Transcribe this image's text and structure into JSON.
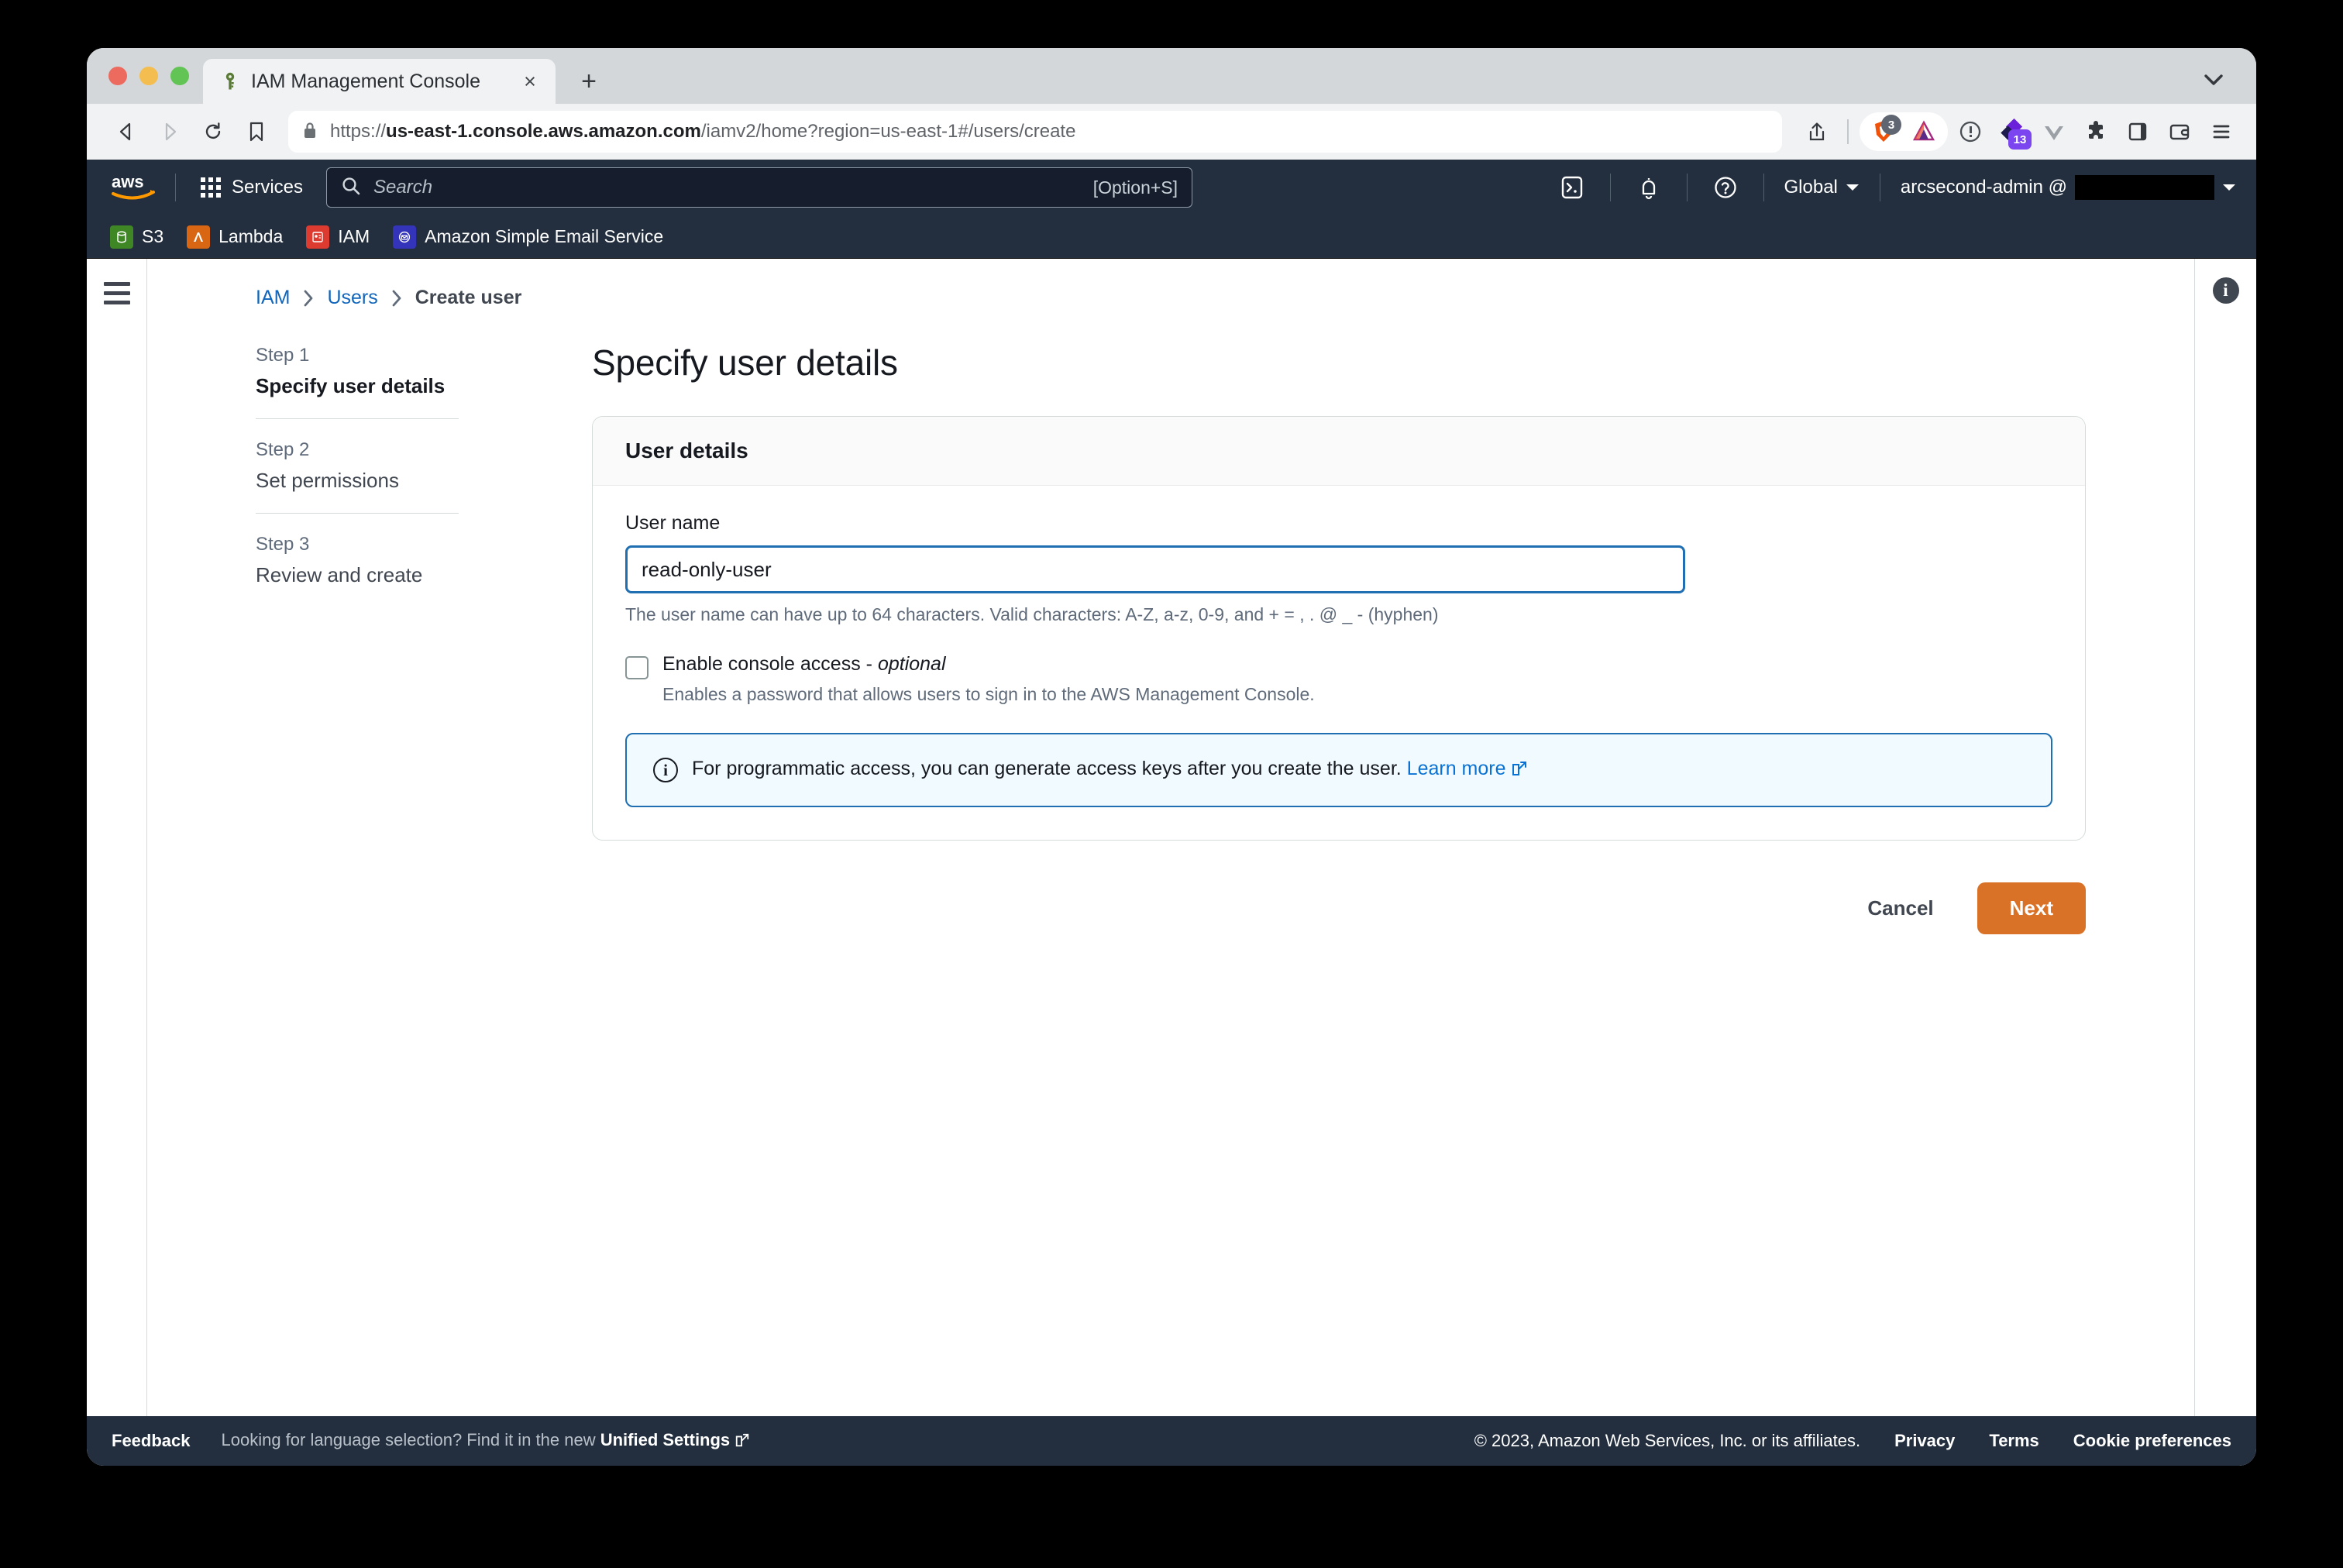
{
  "browser": {
    "tab": {
      "title": "IAM Management Console",
      "favicon": "key-icon",
      "close": "×"
    },
    "newtab_label": "+",
    "url_scheme": "https://",
    "url_domain": "us-east-1.console.aws.amazon.com",
    "url_path": "/iamv2/home?region=us-east-1#/users/create",
    "url_full": "https://us-east-1.console.aws.amazon.com/iamv2/home?region=us-east-1#/users/create",
    "toolbar": {
      "back": "back-icon",
      "forward": "forward-icon",
      "reload": "reload-icon",
      "bookmark": "bookmark-icon",
      "share": "share-icon",
      "brave_shield_count": "3",
      "brave_rewards": "bat-triangle-icon",
      "onepassword": "1password-icon",
      "extension_badge_count": "13",
      "vue_devtools": "vue-icon",
      "puzzle": "extensions-icon",
      "sidebar": "sidebar-icon",
      "wallet": "wallet-icon",
      "menu": "hamburger-menu-icon"
    }
  },
  "aws_nav": {
    "logo": "aws-logo",
    "services_label": "Services",
    "search_placeholder": "Search",
    "search_shortcut": "[Option+S]",
    "cloudshell": "cloudshell-icon",
    "notifications": "bell-icon",
    "help": "help-icon",
    "region": "Global",
    "account": "arcsecond-admin @",
    "account_redacted": true
  },
  "favorites": [
    {
      "label": "S3",
      "icon": "s3-icon",
      "color": "#3f8624"
    },
    {
      "label": "Lambda",
      "icon": "lambda-icon",
      "color": "#d86613"
    },
    {
      "label": "IAM",
      "icon": "iam-icon",
      "color": "#dd3b30"
    },
    {
      "label": "Amazon Simple Email Service",
      "icon": "ses-icon",
      "color": "#3334b9"
    }
  ],
  "breadcrumb": [
    {
      "label": "IAM",
      "current": false
    },
    {
      "label": "Users",
      "current": false
    },
    {
      "label": "Create user",
      "current": true
    }
  ],
  "steps": [
    {
      "num": "Step 1",
      "name": "Specify user details",
      "active": true
    },
    {
      "num": "Step 2",
      "name": "Set permissions",
      "active": false
    },
    {
      "num": "Step 3",
      "name": "Review and create",
      "active": false
    }
  ],
  "page": {
    "title": "Specify user details",
    "info_icon": "info-icon",
    "menu_icon": "hamburger-menu-icon"
  },
  "card": {
    "heading": "User details",
    "username_label": "User name",
    "username_value": "read-only-user",
    "username_placeholder": "",
    "username_help": "The user name can have up to 64 characters. Valid characters: A-Z, a-z, 0-9, and + = , . @ _ - (hyphen)",
    "console_access_label": "Enable console access - ",
    "console_access_optional": "optional",
    "console_access_checked": false,
    "console_access_sub": "Enables a password that allows users to sign in to the AWS Management Console.",
    "alert_text": "For programmatic access, you can generate access keys after you create the user.",
    "alert_link": "Learn more"
  },
  "actions": {
    "cancel_label": "Cancel",
    "next_label": "Next",
    "next_color": "#d97227"
  },
  "footer": {
    "feedback": "Feedback",
    "language_note": "Looking for language selection? Find it in the new ",
    "language_link": "Unified Settings",
    "copyright": "© 2023, Amazon Web Services, Inc. or its affiliates.",
    "privacy": "Privacy",
    "terms": "Terms",
    "cookies": "Cookie preferences"
  },
  "colors": {
    "aws_navy": "#232f3e",
    "accent_orange": "#d97227",
    "link_blue": "#0972d3",
    "focus_blue": "#1f6fb2"
  }
}
